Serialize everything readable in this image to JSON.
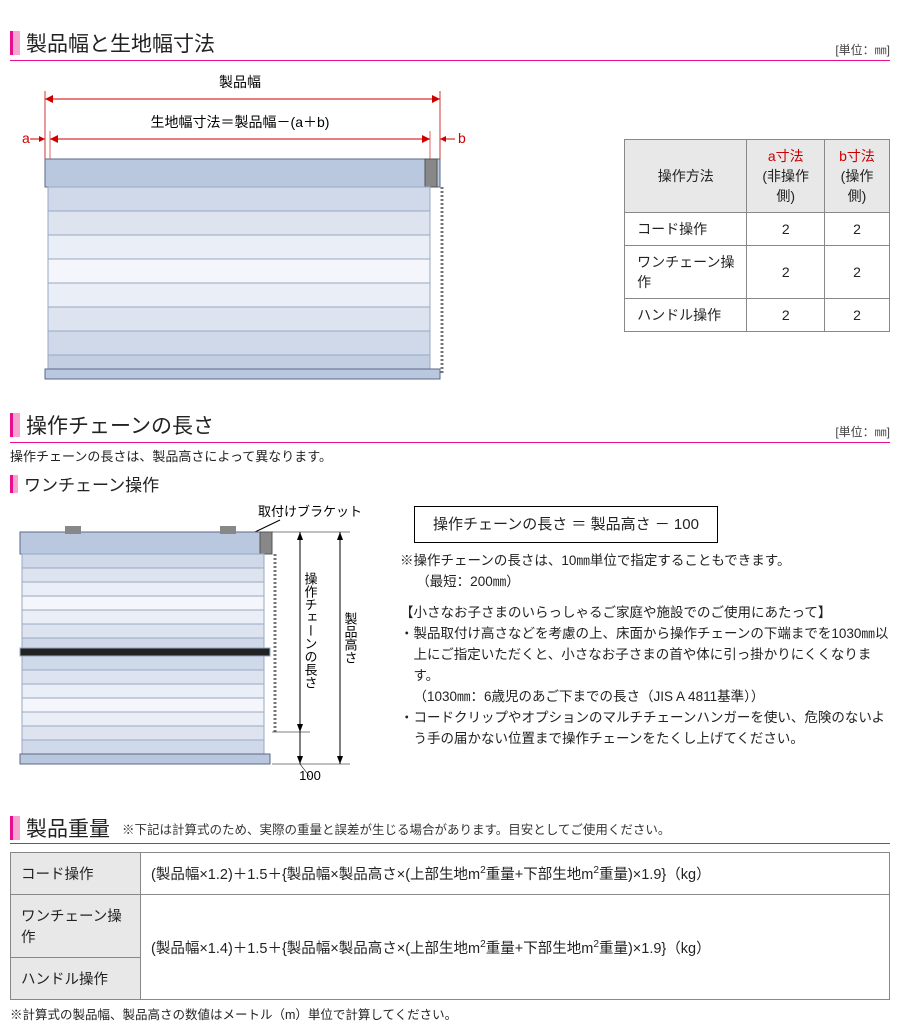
{
  "unit_label": "[単位：㎜]",
  "section1": {
    "title": "製品幅と生地幅寸法",
    "diagram": {
      "product_width_label": "製品幅",
      "fabric_formula": "生地幅寸法＝製品幅－(a＋b)",
      "a": "a",
      "b": "b"
    },
    "table": {
      "headers": {
        "method": "操作方法",
        "a": "a寸法",
        "a_sub": "(非操作側)",
        "b": "b寸法",
        "b_sub": "(操作側)"
      },
      "rows": [
        {
          "method": "コード操作",
          "a": "2",
          "b": "2"
        },
        {
          "method": "ワンチェーン操作",
          "a": "2",
          "b": "2"
        },
        {
          "method": "ハンドル操作",
          "a": "2",
          "b": "2"
        }
      ]
    }
  },
  "section2": {
    "title": "操作チェーンの長さ",
    "intro": "操作チェーンの長さは、製品高さによって異なります。",
    "subhead": "ワンチェーン操作",
    "diagram": {
      "bracket": "取付けブラケット",
      "chain_len": "操作チェーンの長さ",
      "height": "製品高さ",
      "gap": "100"
    },
    "formula": "操作チェーンの長さ ＝ 製品高さ － 100",
    "note1": "※操作チェーンの長さは、10㎜単位で指定することもできます。",
    "note1b": "（最短：200㎜）",
    "safety_title": "【小さなお子さまのいらっしゃるご家庭や施設でのご使用にあたって】",
    "safety1": "・製品取付け高さなどを考慮の上、床面から操作チェーンの下端までを1030㎜以上にご指定いただくと、小さなお子さまの首や体に引っ掛かりにくくなります。",
    "safety1b": "（1030㎜：6歳児のあご下までの長さ（JIS A 4811基準））",
    "safety2": "・コードクリップやオプションのマルチチェーンハンガーを使い、危険のないよう手の届かない位置まで操作チェーンをたくし上げてください。"
  },
  "section3": {
    "title": "製品重量",
    "inline_note": "※下記は計算式のため、実際の重量と誤差が生じる場合があります。目安としてご使用ください。",
    "rows": {
      "r1_label": "コード操作",
      "r1_formula": "(製品幅×1.2)＋1.5＋{製品幅×製品高さ×(上部生地m²重量+下部生地m²重量)×1.9}（kg）",
      "r2_label": "ワンチェーン操作",
      "r3_label": "ハンドル操作",
      "r23_formula": "(製品幅×1.4)＋1.5＋{製品幅×製品高さ×(上部生地m²重量+下部生地m²重量)×1.9}（kg）"
    },
    "footnote": "※計算式の製品幅、製品高さの数値はメートル（m）単位で計算してください。"
  }
}
